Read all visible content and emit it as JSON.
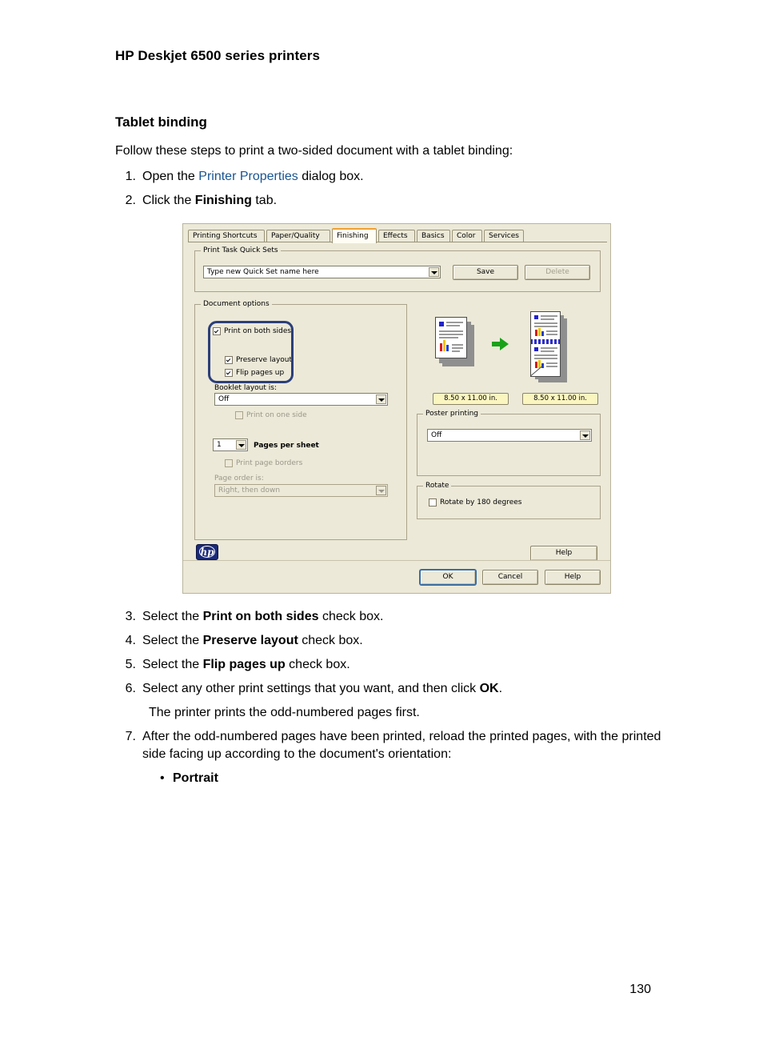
{
  "page": {
    "running_head": "HP Deskjet 6500 series printers",
    "page_number": "130",
    "heading": "Tablet binding",
    "intro": "Follow these steps to print a two-sided document with a tablet binding:"
  },
  "steps_top": [
    {
      "num": "1.",
      "pre": "Open the ",
      "link": "Printer Properties",
      "post": " dialog box."
    },
    {
      "num": "2.",
      "pre": "Click the ",
      "bold": "Finishing",
      "post": " tab."
    }
  ],
  "steps_bottom": [
    {
      "num": "3.",
      "pre": "Select the ",
      "bold": "Print on both sides",
      "post": " check box."
    },
    {
      "num": "4.",
      "pre": "Select the ",
      "bold": "Preserve layout",
      "post": " check box."
    },
    {
      "num": "5.",
      "pre": "Select the ",
      "bold": "Flip pages up",
      "post": " check box."
    },
    {
      "num": "6.",
      "pre": "Select any other print settings that you want, and then click ",
      "bold": "OK",
      "post": "."
    }
  ],
  "step6_note": "The printer prints the odd-numbered pages first.",
  "step7": {
    "num": "7.",
    "text": "After the odd-numbered pages have been printed, reload the printed pages, with the printed side facing up according to the document's orientation:"
  },
  "orientation_bullet": {
    "marker": "•",
    "label": "Portrait"
  },
  "dialog": {
    "tabs": [
      {
        "label": "Printing Shortcuts",
        "active": false
      },
      {
        "label": "Paper/Quality",
        "active": false
      },
      {
        "label": "Finishing",
        "active": true
      },
      {
        "label": "Effects",
        "active": false
      },
      {
        "label": "Basics",
        "active": false
      },
      {
        "label": "Color",
        "active": false
      },
      {
        "label": "Services",
        "active": false
      }
    ],
    "quick_sets": {
      "group_title": "Print Task Quick Sets",
      "combo_value": "Type new Quick Set name here",
      "save_label": "Save",
      "delete_label": "Delete"
    },
    "document_options": {
      "group_title": "Document options",
      "print_both_sides": "Print on both sides",
      "preserve_layout": "Preserve layout",
      "flip_pages_up": "Flip pages up",
      "booklet_layout_label": "Booklet layout is:",
      "booklet_layout_value": "Off",
      "print_one_side": "Print on one side",
      "pages_per_sheet_value": "1",
      "pages_per_sheet_label": "Pages per sheet",
      "print_page_borders": "Print page borders",
      "page_order_label": "Page order is:",
      "page_order_value": "Right, then down"
    },
    "preview": {
      "size_left": "8.50 x 11.00 in.",
      "size_right": "8.50 x 11.00 in."
    },
    "poster_printing": {
      "group_title": "Poster printing",
      "value": "Off"
    },
    "rotate": {
      "group_title": "Rotate",
      "checkbox_label": "Rotate by 180 degrees"
    },
    "logo_text": "hp",
    "help_label": "Help",
    "buttons": {
      "ok": "OK",
      "cancel": "Cancel",
      "help": "Help"
    }
  },
  "colors": {
    "link": "#1a5491",
    "dialog_face": "#ece9d8",
    "tab_active_accent": "#f0a030",
    "callout": "#2b3f7a",
    "badge": "#fbf5c0",
    "hp_blue": "#1b2a78",
    "green_arrow": "#22aa22"
  }
}
